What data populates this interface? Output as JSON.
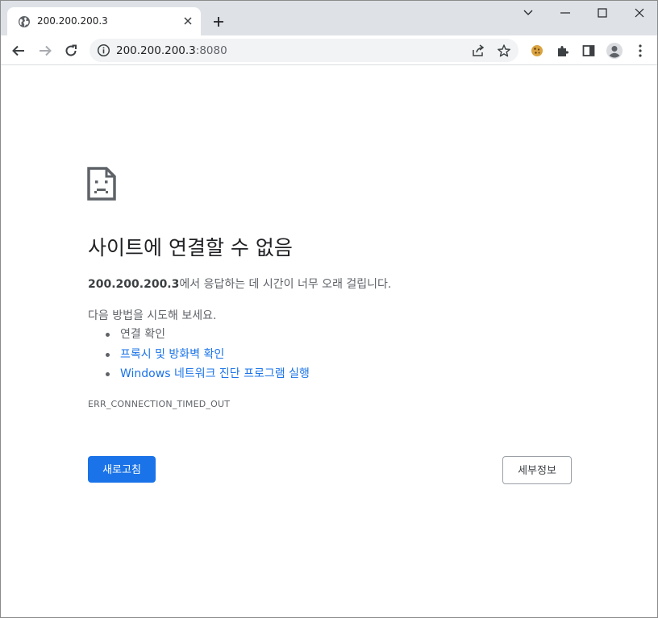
{
  "tab": {
    "title": "200.200.200.3",
    "favicon": "globe-icon"
  },
  "window_controls": {
    "dropdown": "chevron-down-icon",
    "minimize": "minimize-icon",
    "maximize": "maximize-icon",
    "close": "close-icon"
  },
  "toolbar": {
    "url_host": "200.200.200.3",
    "url_port": ":8080",
    "icons": [
      "back-icon",
      "forward-icon",
      "reload-icon",
      "info-icon",
      "share-icon",
      "star-icon",
      "cookie-extension-icon",
      "puzzle-icon",
      "side-panel-icon",
      "profile-icon",
      "menu-icon"
    ]
  },
  "error": {
    "icon": "sad-document-icon",
    "title": "사이트에 연결할 수 없음",
    "host": "200.200.200.3",
    "message": "에서 응답하는 데 시간이 너무 오래 걸립니다.",
    "suggestions_heading": "다음 방법을 시도해 보세요.",
    "suggestions": [
      {
        "label": "연결 확인",
        "link": false
      },
      {
        "label": "프록시 및 방화벽 확인",
        "link": true
      },
      {
        "label": "Windows 네트워크 진단 프로그램 실행",
        "link": true
      }
    ],
    "code": "ERR_CONNECTION_TIMED_OUT",
    "reload_label": "새로고침",
    "details_label": "세부정보"
  },
  "colors": {
    "accent": "#1a73e8",
    "titlebar": "#dee1e6",
    "omnibox": "#f1f3f4",
    "text_secondary": "#5f6368"
  }
}
